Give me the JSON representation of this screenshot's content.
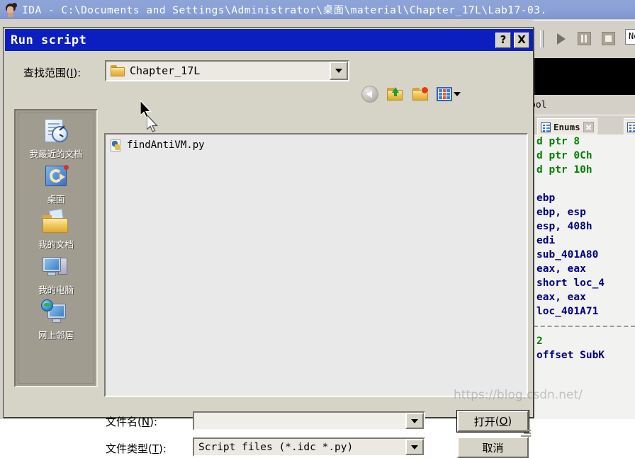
{
  "ida": {
    "title": "IDA - C:\\Documents and Settings\\Administrator\\桌面\\material\\Chapter_17L\\Lab17-03.",
    "logo_icon": "ida-woman-logo-icon",
    "toolbar": {
      "play_icon": "play-icon",
      "pause_icon": "pause-icon",
      "stop_icon": "stop-icon",
      "debugger_combo_value": "No d"
    },
    "symbol_label": "bol",
    "tabs": [
      {
        "label": "Enums",
        "icon": "enums-list-icon",
        "close_icon": "close-icon"
      }
    ],
    "disassembly": {
      "block1": [
        "d ptr   8",
        "d ptr   0Ch",
        "d ptr   10h"
      ],
      "block2": [
        "ebp",
        "ebp, esp",
        "esp, 408h",
        "edi",
        "sub_401A80",
        "eax, eax",
        "short loc_4",
        "eax, eax",
        "loc_401A71"
      ],
      "block3": [
        "2",
        "offset SubK"
      ]
    }
  },
  "dialog": {
    "title": "Run script",
    "help_button": "?",
    "close_button": "X",
    "lookin": {
      "label_pre": "查找范围",
      "label_key": "I",
      "label_post": "):",
      "value": "Chapter_17L",
      "folder_icon": "folder-icon",
      "dropdown_icon": "chevron-down-icon"
    },
    "toolbar": [
      {
        "name": "back-button",
        "icon": "back-arrow-icon"
      },
      {
        "name": "up-one-level-button",
        "icon": "folder-up-icon"
      },
      {
        "name": "create-new-folder-button",
        "icon": "folder-new-icon"
      },
      {
        "name": "views-button",
        "icon": "views-grid-icon"
      }
    ],
    "places": [
      {
        "label": "我最近的文档",
        "icon": "recent-documents-icon"
      },
      {
        "label": "桌面",
        "icon": "desktop-icon"
      },
      {
        "label": "我的文档",
        "icon": "my-documents-icon"
      },
      {
        "label": "我的电脑",
        "icon": "my-computer-icon"
      },
      {
        "label": "网上邻居",
        "icon": "network-places-icon"
      }
    ],
    "files": [
      {
        "name": "findAntiVM.py",
        "icon": "python-file-icon"
      }
    ],
    "filename": {
      "label_pre": "文件名",
      "label_key": "N",
      "label_post": "):",
      "value": "",
      "dropdown_icon": "chevron-down-icon"
    },
    "filetype": {
      "label_pre": "文件类型",
      "label_key": "T",
      "label_post": "):",
      "value": "Script files (*.idc *.py)",
      "dropdown_icon": "chevron-down-icon"
    },
    "buttons": {
      "open_pre": "打开",
      "open_key": "O",
      "open_post": ")",
      "cancel": "取消"
    }
  },
  "watermark": "https://blog.csdn.net/",
  "cursors": [
    {
      "name": "mouse-pointer-primary"
    },
    {
      "name": "mouse-pointer-secondary"
    }
  ]
}
